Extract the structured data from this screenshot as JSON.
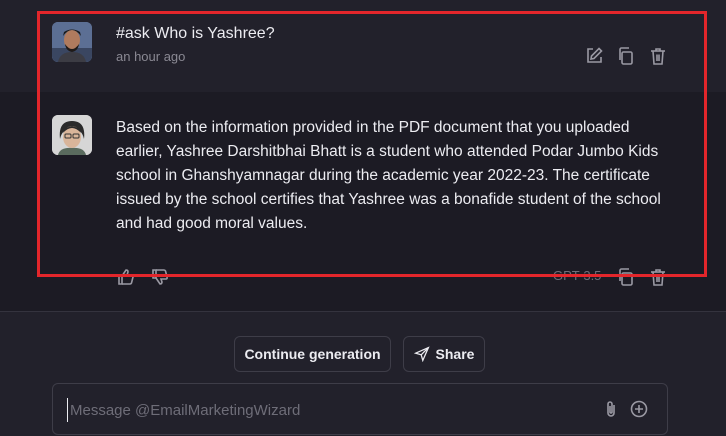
{
  "user_message": {
    "text": "#ask Who is Yashree?",
    "time": "an hour ago"
  },
  "bot_message": {
    "text": "Based on the information provided in the PDF document that you uploaded earlier, Yashree Darshitbhai Bhatt is a student who attended Podar Jumbo Kids school in Ghanshyamnagar during the academic year 2022-23. The certificate issued by the school certifies that Yashree was a bonafide student of the school and had good moral values.",
    "model": "GPT-3.5"
  },
  "actions": {
    "continue_label": "Continue generation",
    "share_label": "Share"
  },
  "composer": {
    "placeholder": "Message @EmailMarketingWizard"
  },
  "colors": {
    "background": "#22212b",
    "bot_background": "#1c1b24",
    "highlight": "#e3262b",
    "text": "#ececf1",
    "muted": "#8a8993"
  },
  "icons": {
    "user_actions": [
      "edit-icon",
      "copy-icon",
      "delete-icon"
    ],
    "bot_actions": [
      "thumbs-up-icon",
      "thumbs-down-icon",
      "copy-icon",
      "delete-icon"
    ],
    "composer": [
      "paperclip-icon",
      "plus-circle-icon"
    ],
    "share": "send-icon"
  }
}
